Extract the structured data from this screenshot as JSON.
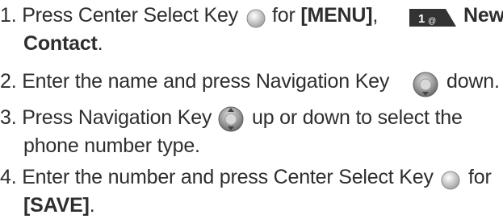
{
  "steps": [
    {
      "number": "1.",
      "line1_text": "Press Center Select Key",
      "line1_for": "for",
      "menu_label": "[MENU]",
      "comma": ",",
      "key_badge_text": "1",
      "key_badge_sub": "@",
      "new_label": "New",
      "line2_bold": "Contact",
      "line2_period": "."
    },
    {
      "number": "2.",
      "text_before_icon": "Enter the name and press Navigation Key",
      "text_after_icon": "down."
    },
    {
      "number": "3.",
      "text_before_icon": "Press Navigation Key",
      "text_after_icon": "up or down to select the",
      "line2": "phone number type."
    },
    {
      "number": "4.",
      "text_before_icon": "Enter the number and press Center Select Key",
      "text_after_icon": "for",
      "line2_bold": "[SAVE]",
      "line2_period": "."
    }
  ],
  "icons": {
    "center_select_key": "center-select-key-icon",
    "key_1_badge": "key-1-badge-icon",
    "navigation_key_down": "navigation-key-down-icon",
    "navigation_key_updown": "navigation-key-updown-icon"
  },
  "colors": {
    "text": "#2e2e2e",
    "badge_dark": "#333333",
    "icon_light": "#e6e6e6",
    "icon_mid": "#a9a9a9",
    "icon_dark": "#6b6b6b"
  }
}
